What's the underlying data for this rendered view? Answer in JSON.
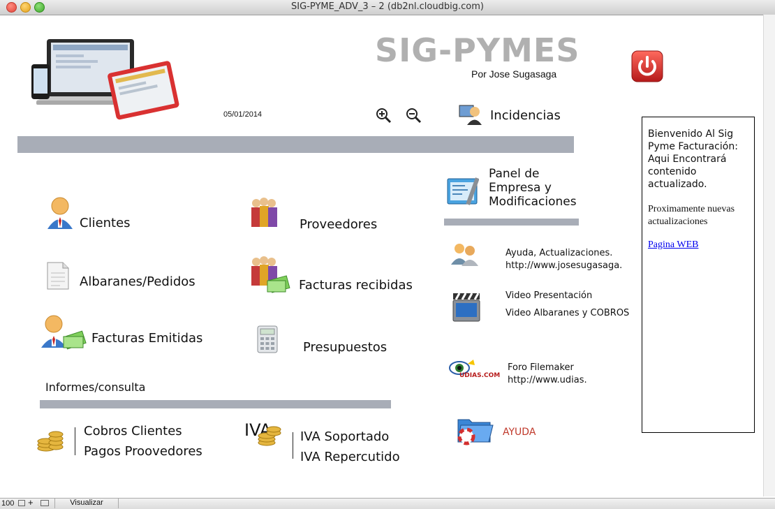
{
  "window": {
    "title": "SIG-PYME_ADV_3 – 2 (db2nl.cloudbig.com)"
  },
  "header": {
    "app_name": "SIG-PYMES",
    "author": "Por Jose Sugasaga",
    "date": "05/01/2014",
    "incidencias_label": "Incidencias"
  },
  "nav": {
    "clientes": "Clientes",
    "proveedores": "Proveedores",
    "albaranes": "Albaranes/Pedidos",
    "facturas_recibidas": "Facturas recibidas",
    "facturas_emitidas": "Facturas Emitidas",
    "presupuestos": "Presupuestos"
  },
  "informes": {
    "heading": "Informes/consulta",
    "cobros_clientes": "Cobros Clientes",
    "pagos_proveedores": "Pagos Proovedores",
    "iva_icon_text": "IVA",
    "iva_soportado": "IVA Soportado",
    "iva_repercutido": "IVA Repercutido"
  },
  "panel": {
    "line1": "Panel de",
    "line2": "Empresa y",
    "line3": "Modificaciones",
    "ayuda_line1": "Ayuda, Actualizaciones.",
    "ayuda_line2": "http://www.josesugasaga.",
    "video1": "Video Presentación",
    "video2": "Video Albaranes y COBROS",
    "foro_line1": "Foro Filemaker",
    "foro_line2": "http://www.udias.",
    "foro_logo_text": "UDIAS.COM",
    "ayuda_button": "AYUDA"
  },
  "welcome": {
    "text1": "Bienvenido Al Sig Pyme Facturación: Aqui Encontrará contenido actualizado.",
    "text2": "Proximamente nuevas actualizaciones",
    "link": "Pagina WEB"
  },
  "statusbar": {
    "zoom": "100",
    "mode": "Visualizar"
  },
  "colors": {
    "gray_bar": "#a8adb7",
    "title_gray": "#b0b0b0",
    "power_red": "#d8262a",
    "link_blue": "#0000ee",
    "ayuda_red": "#c0392b"
  }
}
